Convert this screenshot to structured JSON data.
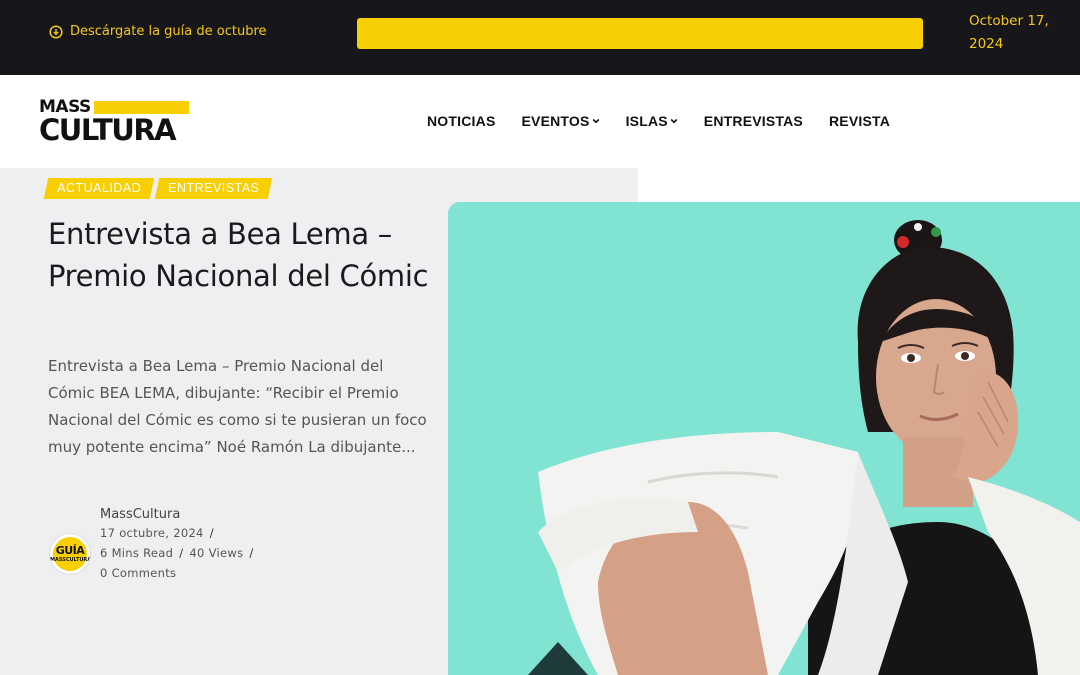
{
  "topbar": {
    "guide_link": "Descárgate la guía de octubre",
    "date": "October 17, 2024",
    "accent_color": "#f5c816"
  },
  "header": {
    "logo_top": "MASS",
    "logo_bottom": "CULTURA",
    "nav": [
      {
        "label": "NOTICIAS",
        "has_dropdown": false
      },
      {
        "label": "EVENTOS",
        "has_dropdown": true
      },
      {
        "label": "ISLAS",
        "has_dropdown": true
      },
      {
        "label": "ENTREVISTAS",
        "has_dropdown": false
      },
      {
        "label": "REVISTA",
        "has_dropdown": false
      }
    ]
  },
  "article": {
    "tags": [
      "ACTUALIDAD",
      "ENTREVISTAS"
    ],
    "title": "Entrevista a Bea Lema – Premio Nacional del Cómic",
    "excerpt": "Entrevista a Bea Lema – Premio Nacional del Cómic BEA LEMA, dibujante: “Recibir el Premio Nacional del Cómic es como si te pusieran un foco muy potente encima” Noé Ramón La dibujante...",
    "author": "MassCultura",
    "date": "17 octubre, 2024",
    "read_time": "6 Mins Read",
    "views": "40 Views",
    "comments": "0 Comments",
    "avatar_text_top": "GUÍA",
    "avatar_text_bottom": "MASSCULTURA",
    "separator": "/"
  },
  "colors": {
    "brand_yellow": "#f7cf03",
    "topbar_bg": "#17171b",
    "photo_bg": "#7de2cf"
  }
}
